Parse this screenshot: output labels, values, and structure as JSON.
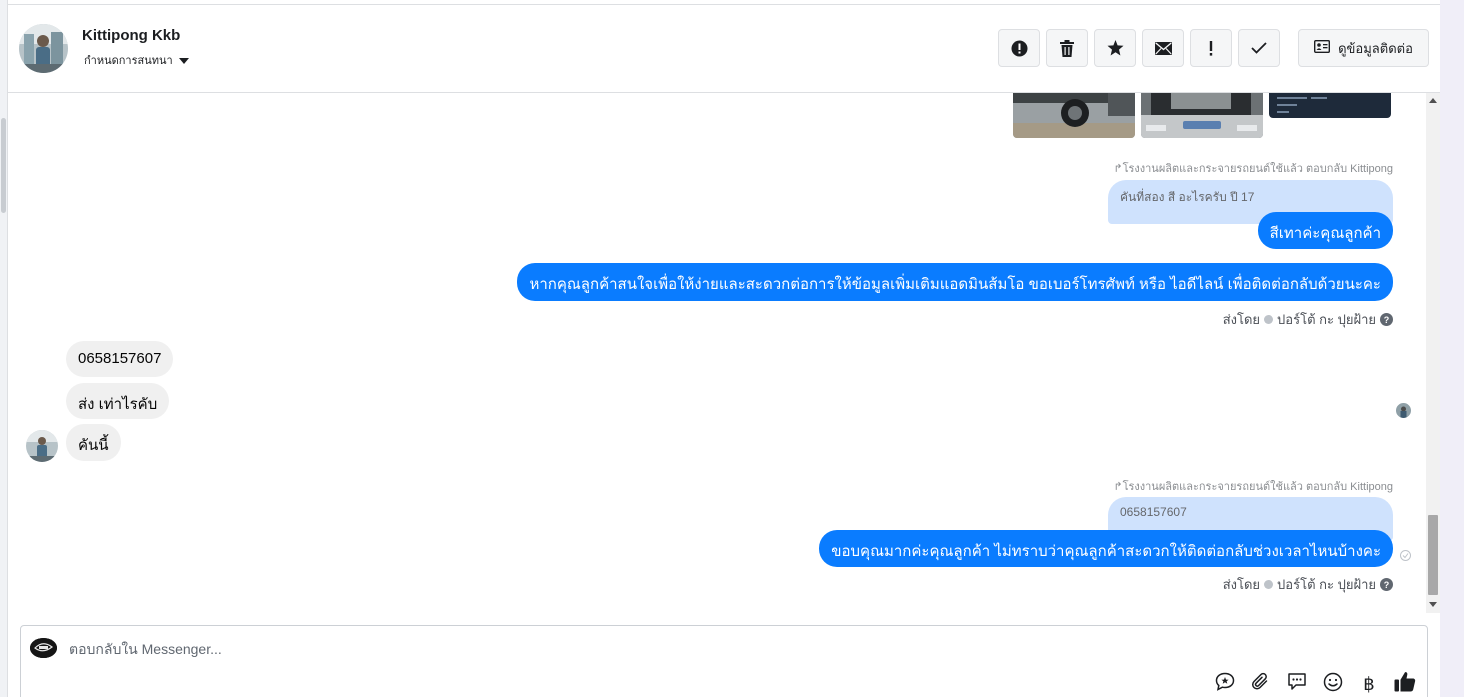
{
  "header": {
    "contact_name": "Kittipong Kkb",
    "assign_label": "กำหนดการสนทนา",
    "contact_info_label": "ดูข้อมูลติดต่อ"
  },
  "toolbar": {
    "icons": [
      "alert-icon",
      "trash-icon",
      "star-icon",
      "envelope-icon",
      "exclamation-icon",
      "checkmark-icon"
    ]
  },
  "thread": {
    "reply_1": {
      "meta": "โรงงานผลิตและกระจายรถยนต์ใช้แล้ว ตอบกลับ Kittipong",
      "quoted": "คันที่สอง สี อะไรครับ ปี 17",
      "reply": "สีเทาค่ะคุณลูกค้า"
    },
    "outgoing_2": "หากคุณลูกค้าสนใจเพื่อให้ง่ายและสะดวกต่อการให้ข้อมูลเพิ่มเติมแอดมินส้มโอ ขอเบอร์โทรศัพท์ หรือ ไอดีไลน์ เพื่อติดต่อกลับด้วยนะคะ",
    "sent_by_1": {
      "prefix": "ส่งโดย",
      "name": "ปอร์โต้ กะ ปุยฝ้าย",
      "help": "?"
    },
    "incoming": [
      "0658157607",
      "ส่ง เท่าไรคับ",
      "คันนี้"
    ],
    "reply_2": {
      "meta": "โรงงานผลิตและกระจายรถยนต์ใช้แล้ว ตอบกลับ Kittipong",
      "quoted": "0658157607",
      "reply": "ขอบคุณมากค่ะคุณลูกค้า ไม่ทราบว่าคุณลูกค้าสะดวกให้ติดต่อกลับช่วงเวลาไหนบ้างคะ"
    },
    "sent_by_2": {
      "prefix": "ส่งโดย",
      "name": "ปอร์โต้ กะ ปุยฝ้าย",
      "help": "?"
    }
  },
  "composer": {
    "placeholder": "ตอบกลับใน Messenger..."
  },
  "colors": {
    "accent": "#0a7cff",
    "quote_bg": "#cfe2fd",
    "incoming_bg": "#f0f0f0"
  }
}
